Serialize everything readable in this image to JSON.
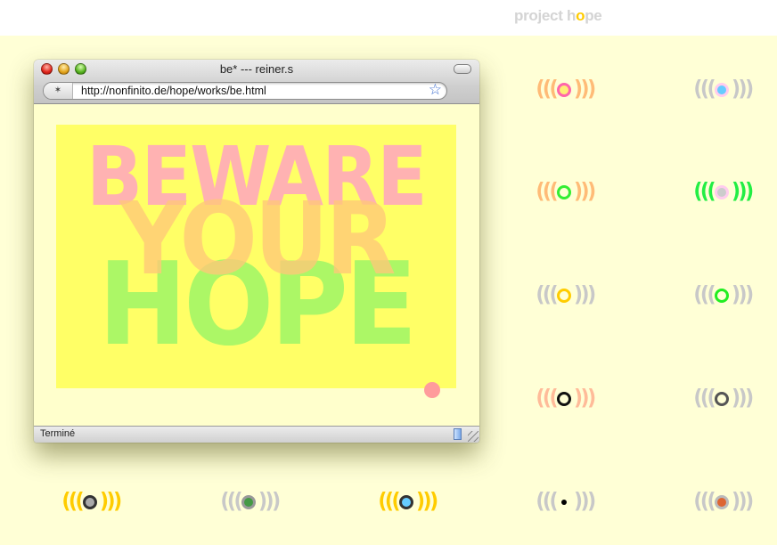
{
  "logo": {
    "before": "project h",
    "highlight": "o",
    "after": "pe"
  },
  "window": {
    "title": "be* --- reiner.s",
    "url": "http://nonfinito.de/hope/works/be.html",
    "status": "Terminé"
  },
  "poster": {
    "line1": "BEWARE",
    "line2": "YOUR",
    "line3": "HOPE"
  },
  "signals": [
    {
      "id": "r1c4",
      "wave_color": "#ffbb77",
      "ring_color": "#ff66aa",
      "center_color": "#ffee77"
    },
    {
      "id": "r1c5",
      "wave_color": "#c8c8c8",
      "ring_color": "#ffccee",
      "center_color": "#66ccff"
    },
    {
      "id": "r2c4",
      "wave_color": "#ffbb77",
      "ring_color": "#33ee33",
      "center_color": "#ffffd6"
    },
    {
      "id": "r2c5",
      "wave_color": "#22ee44",
      "ring_color": "#ffccee",
      "center_color": "#cccccc"
    },
    {
      "id": "r3c4",
      "wave_color": "#c8c8c8",
      "ring_color": "#ffcc00",
      "center_color": "#ffffd6"
    },
    {
      "id": "r3c5",
      "wave_color": "#c8c8c8",
      "ring_color": "#22ee22",
      "center_color": "#ffffd6"
    },
    {
      "id": "r4c4",
      "wave_color": "#ffbb99",
      "ring_color": "#111111",
      "center_color": "#ffffd6"
    },
    {
      "id": "r4c5",
      "wave_color": "#c8c8c8",
      "ring_color": "#555555",
      "center_color": "#ffffd6"
    },
    {
      "id": "r5c1",
      "wave_color": "#ffcc00",
      "ring_color": "#333333",
      "center_color": "#aaaaaa"
    },
    {
      "id": "r5c2",
      "wave_color": "#c8c8c8",
      "ring_color": "#999999",
      "center_color": "#449944"
    },
    {
      "id": "r5c3",
      "wave_color": "#ffcc00",
      "ring_color": "#333333",
      "center_color": "#66ccff"
    },
    {
      "id": "r5c4",
      "wave_color": "#c8c8c8",
      "ring_color": "#ffffd6",
      "center_color": "#000000"
    },
    {
      "id": "r5c5",
      "wave_color": "#c8c8c8",
      "ring_color": "#bbbbbb",
      "center_color": "#dd6633"
    }
  ]
}
